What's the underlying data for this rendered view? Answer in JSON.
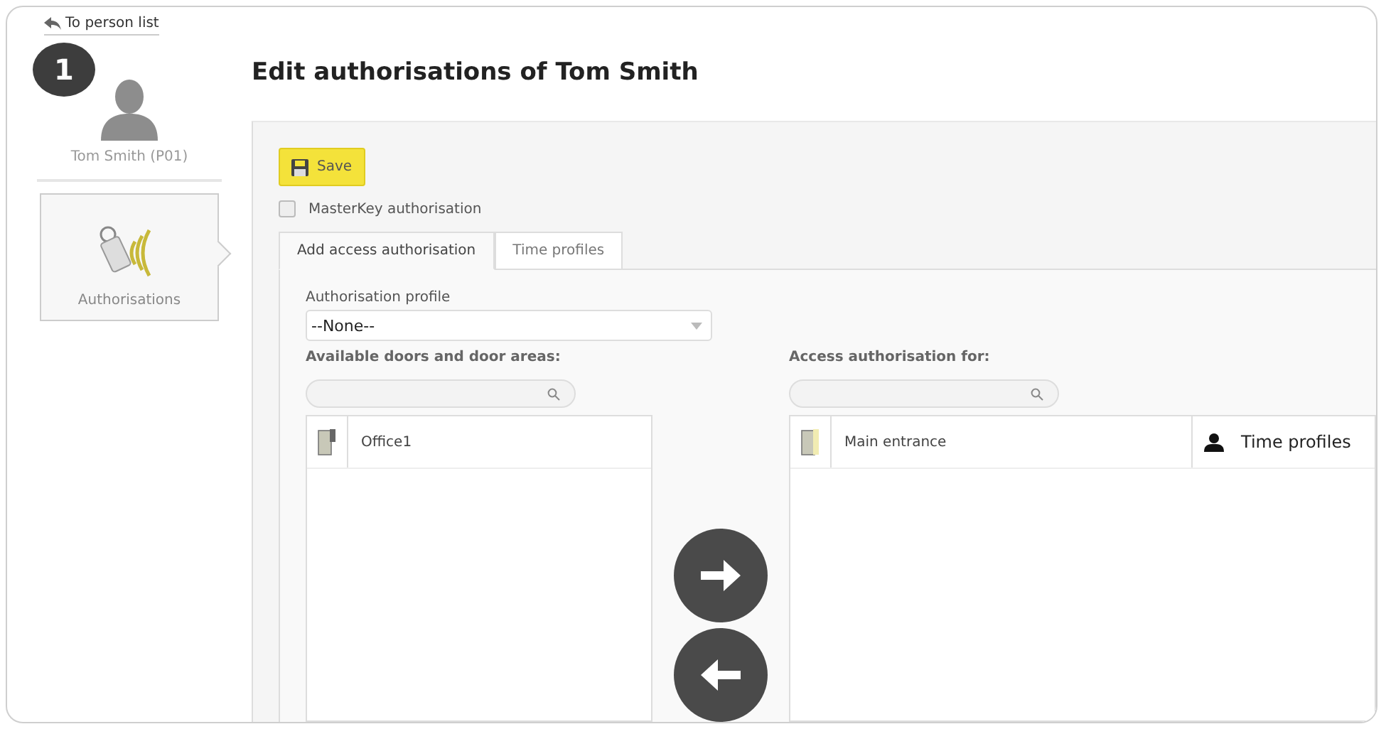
{
  "back_link": "To person list",
  "step_badge": "1",
  "person": {
    "name": "Tom Smith (P01)"
  },
  "sidebar": {
    "items": [
      {
        "label": "Authorisations",
        "selected": true
      }
    ]
  },
  "title": "Edit authorisations of Tom Smith",
  "save_button": "Save",
  "masterkey": {
    "label": "MasterKey authorisation",
    "checked": false
  },
  "tabs": [
    {
      "label": "Add access authorisation",
      "selected": true
    },
    {
      "label": "Time profiles",
      "selected": false
    }
  ],
  "profile": {
    "label": "Authorisation profile",
    "value": "--None--"
  },
  "available": {
    "label": "Available doors and door areas:",
    "rows": [
      {
        "name": "Office1"
      }
    ]
  },
  "assigned": {
    "label": "Access authorisation for:",
    "rows": [
      {
        "name": "Main entrance",
        "column_2": "Time profiles"
      }
    ]
  }
}
